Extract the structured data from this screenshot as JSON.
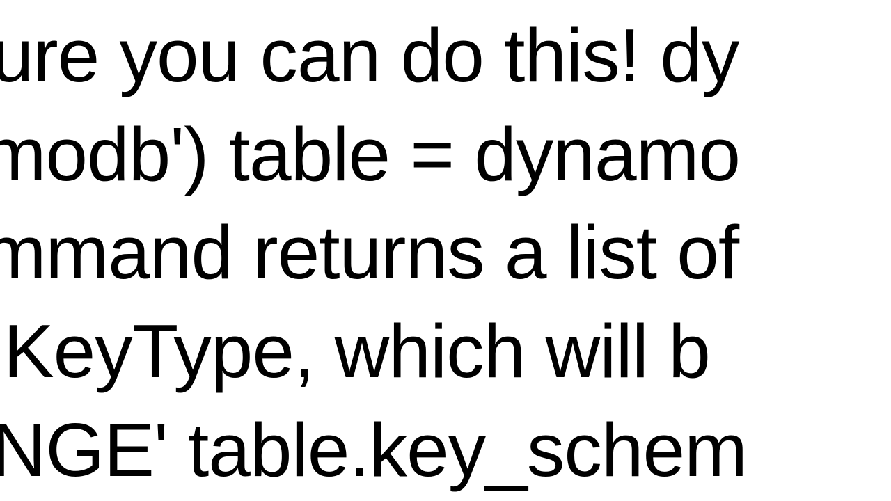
{
  "lines": {
    "l1": "Sure you can do this! dy",
    "l2": "amodb') table = dynamo",
    "l3": "ommand returns a list of",
    "l4": "d KeyType, which will b",
    "l5": "ANGE' table.key_schem"
  }
}
